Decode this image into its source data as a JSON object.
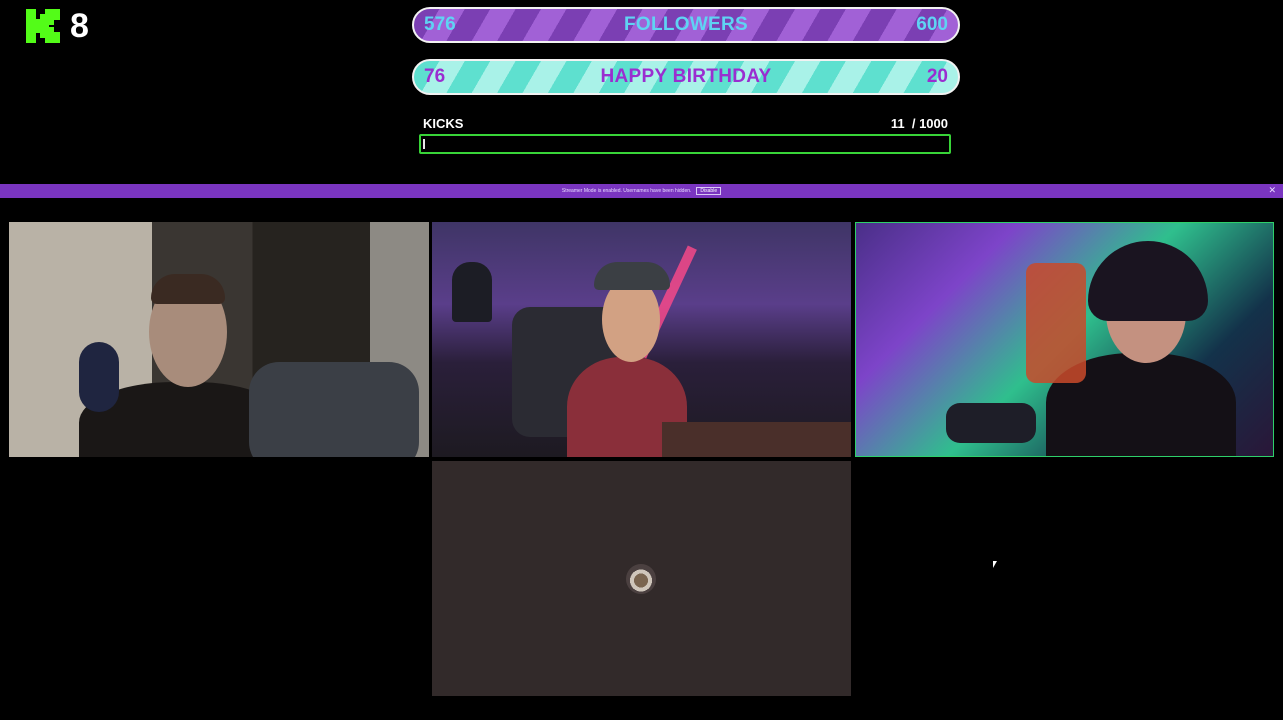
{
  "kick": {
    "count": "8",
    "logo_icon": "kick-logo-icon",
    "brand_color": "#53fc18"
  },
  "goals": [
    {
      "current": "576",
      "title": "FOLLOWERS",
      "target": "600",
      "colors": {
        "stripe_a": "#7b3fb3",
        "stripe_b": "#a161d6",
        "text": "#5fd3f3"
      }
    },
    {
      "current": "76",
      "title": "HAPPY BIRTHDAY",
      "target": "20",
      "colors": {
        "stripe_a": "#5ee0cf",
        "stripe_b": "#a9f2e8",
        "text": "#9a2ed0"
      }
    }
  ],
  "kicks": {
    "label": "KICKS",
    "current": "11",
    "goal": "/ 1000",
    "progress_fraction": 0.011,
    "bar_color": "#38d438"
  },
  "banner": {
    "message": "Streamer Mode is enabled. Usernames have been hidden.",
    "button_label": "Disable",
    "close_icon": "close-icon",
    "color": "#7a35c0"
  },
  "tiles": [
    {
      "name": "participant-1",
      "active": false
    },
    {
      "name": "participant-2",
      "active": false
    },
    {
      "name": "participant-3",
      "active": true,
      "active_border_color": "#2ed06a"
    },
    {
      "name": "participant-4",
      "camera_off": true,
      "avatar_icon": "user-avatar-icon"
    }
  ]
}
